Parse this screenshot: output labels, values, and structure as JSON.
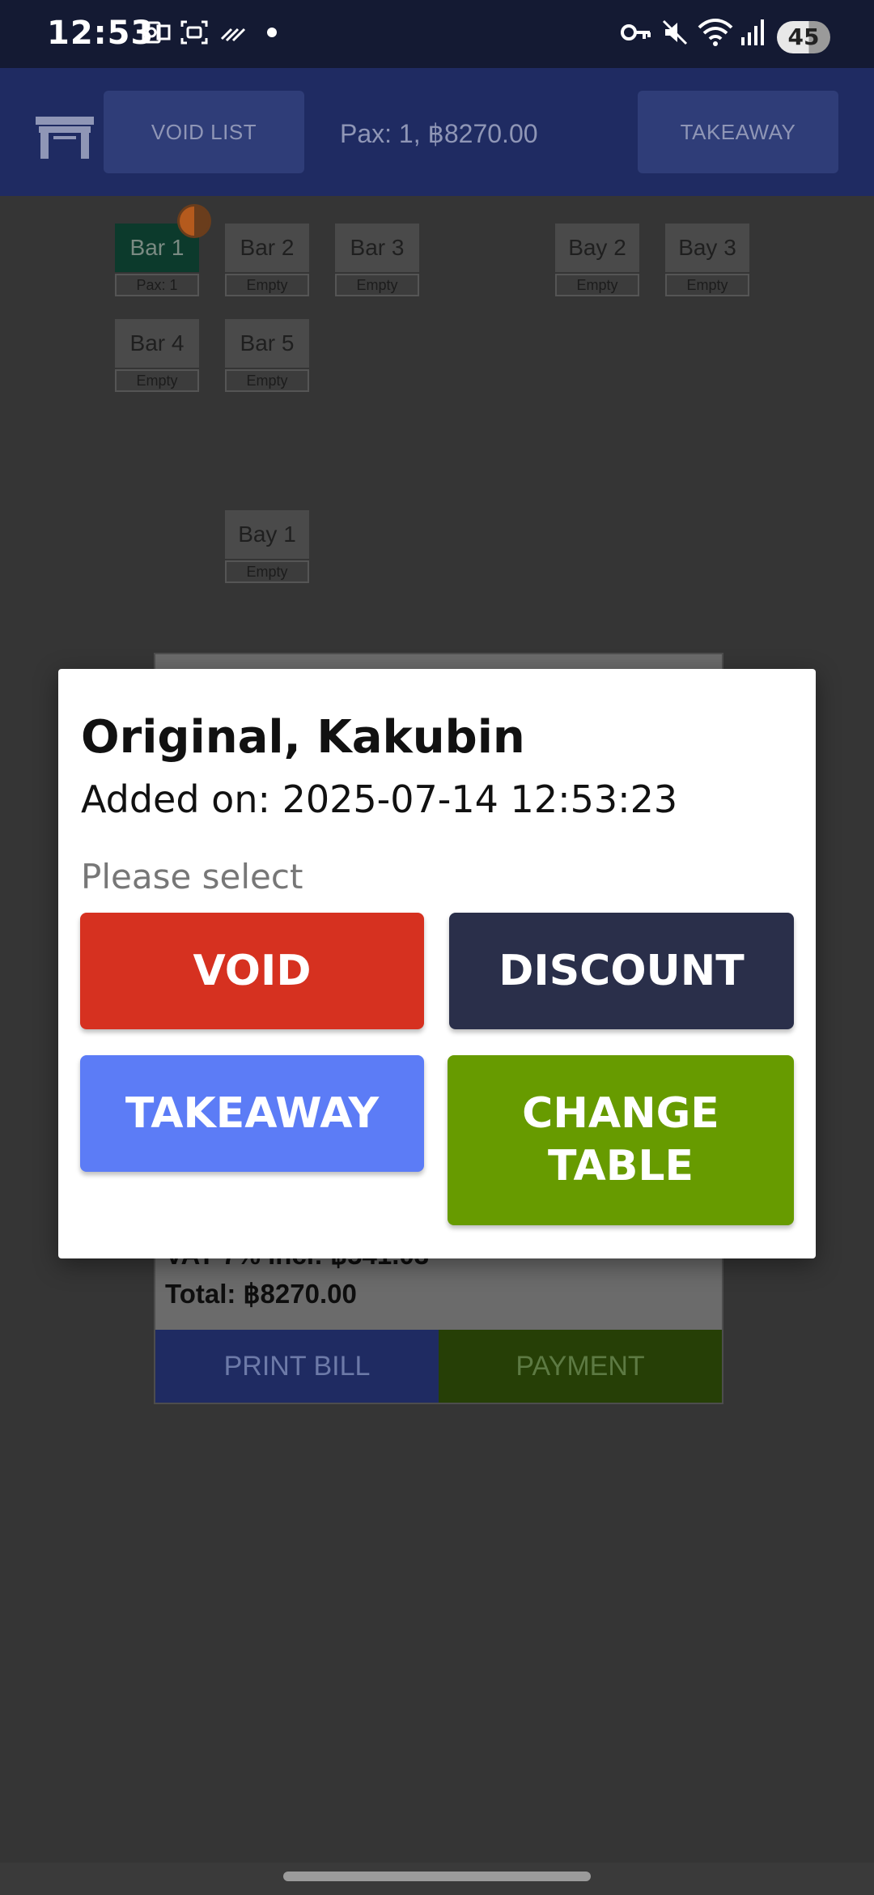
{
  "status_bar": {
    "time": "12:53",
    "battery": "45",
    "icons": [
      "outlook-icon",
      "screenshot-icon",
      "data-saver-icon",
      "dot-icon",
      "vpn-key-icon",
      "mute-icon",
      "wifi-icon",
      "signal-icon"
    ]
  },
  "header": {
    "void_list_label": "VOID LIST",
    "pax_summary": "Pax: 1, ฿8270.00",
    "takeaway_label": "TAKEAWAY"
  },
  "tables": [
    {
      "name": "Bar 1",
      "status": "Pax: 1",
      "active": true
    },
    {
      "name": "Bar 2",
      "status": "Empty",
      "active": false
    },
    {
      "name": "Bar 3",
      "status": "Empty",
      "active": false
    },
    {
      "name": "Bay 2",
      "status": "Empty",
      "active": false
    },
    {
      "name": "Bay 3",
      "status": "Empty",
      "active": false
    },
    {
      "name": "Bar 4",
      "status": "Empty",
      "active": false
    },
    {
      "name": "Bar 5",
      "status": "Empty",
      "active": false
    },
    {
      "name": "Bay 1",
      "status": "Empty",
      "active": false
    }
  ],
  "order_panel": {
    "vat_line": "VAT 7% incl: ฿541.03",
    "total_line": "Total: ฿8270.00",
    "print_bill_label": "PRINT BILL",
    "payment_label": "PAYMENT"
  },
  "dialog": {
    "title": "Original, Kakubin",
    "added_on": "Added on: 2025-07-14 12:53:23",
    "hint": "Please select",
    "void_label": "VOID",
    "discount_label": "DISCOUNT",
    "takeaway_label": "TAKEAWAY",
    "change_table_label": "CHANGE TABLE"
  },
  "colors": {
    "void": "#d63120",
    "discount": "#2a2f4a",
    "takeaway": "#5c7cf6",
    "change_table": "#679b00",
    "header_bg": "#1f2b62"
  }
}
